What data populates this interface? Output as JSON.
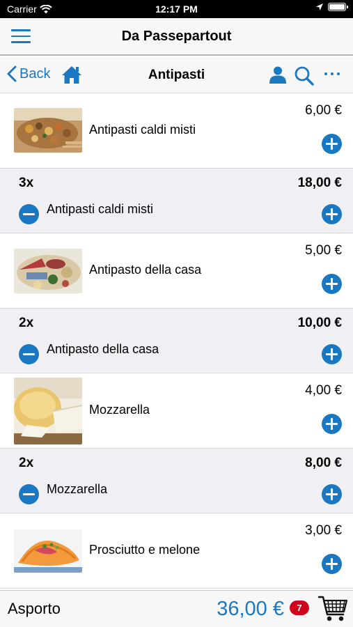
{
  "status_bar": {
    "carrier": "Carrier",
    "time": "12:17 PM"
  },
  "header": {
    "title": "Da Passepartout",
    "menu_icon": "hamburger-menu-icon"
  },
  "nav": {
    "back_label": "Back",
    "title": "Antipasti",
    "icons": [
      "home-icon",
      "user-icon",
      "search-icon",
      "more-icon"
    ]
  },
  "colors": {
    "accent": "#1a78c2",
    "badge": "#d0021b",
    "order_background": "#efeff4"
  },
  "menu_items": [
    {
      "name": "Antipasti caldi misti",
      "price": "6,00 €"
    },
    {
      "name": "Antipasto della casa",
      "price": "5,00 €"
    },
    {
      "name": "Mozzarella",
      "price": "4,00 €"
    },
    {
      "name": "Prosciutto e melone",
      "price": "3,00 €"
    }
  ],
  "order_lines": [
    {
      "qty": "3x",
      "name": "Antipasti caldi misti",
      "total": "18,00 €"
    },
    {
      "qty": "2x",
      "name": "Antipasto della casa",
      "total": "10,00 €"
    },
    {
      "qty": "2x",
      "name": "Mozzarella",
      "total": "8,00 €"
    }
  ],
  "footer": {
    "label": "Asporto",
    "total": "36,00 €",
    "badge": "7",
    "cart_icon": "shopping-cart-icon"
  }
}
